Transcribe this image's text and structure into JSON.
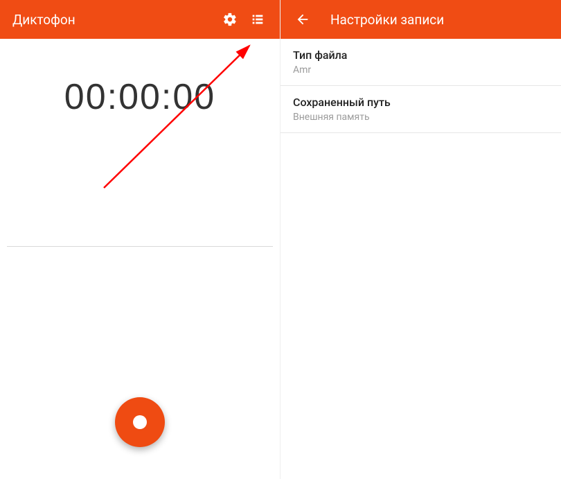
{
  "colors": {
    "accent": "#F04C14",
    "record": "#EF4B12",
    "arrow": "#FF0000"
  },
  "recorder": {
    "title": "Диктофон",
    "timer": "00:00:00"
  },
  "settings": {
    "title": "Настройки записи",
    "items": [
      {
        "title": "Тип файла",
        "subtitle": "Amr"
      },
      {
        "title": "Сохраненный путь",
        "subtitle": "Внешняя память"
      }
    ]
  }
}
